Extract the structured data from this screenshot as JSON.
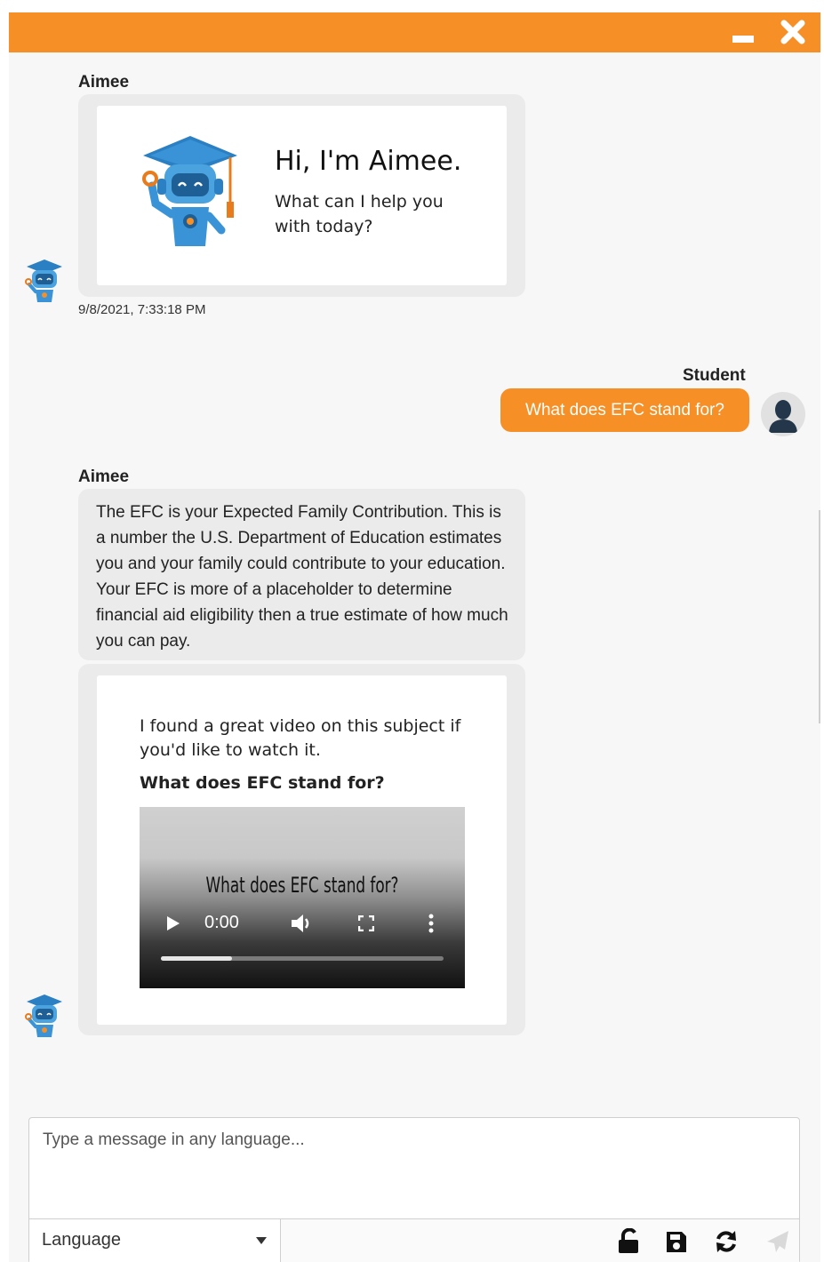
{
  "window": {
    "accent_color": "#f58f26",
    "minimize_icon": "minimize-icon",
    "close_icon": "close-icon"
  },
  "messages": {
    "greeting": {
      "sender": "Aimee",
      "title": "Hi, I'm Aimee.",
      "subtitle": "What can I help you with today?",
      "timestamp": "9/8/2021, 7:33:18 PM"
    },
    "student": {
      "sender": "Student",
      "text": "What does EFC stand for?"
    },
    "answer": {
      "sender": "Aimee",
      "text": "The EFC is your Expected Family Contribution. This is a number the U.S. Department of Education estimates you and your family could contribute to your education. Your EFC is more of a placeholder to determine financial aid eligibility then a true estimate of how much you can pay.",
      "video_intro": "I found a great video on this subject if you'd like to watch it.",
      "video_heading": "What does EFC stand for?",
      "video": {
        "title": "What does EFC stand for?",
        "time": "0:00",
        "progress": 0.25
      }
    }
  },
  "composer": {
    "placeholder": "Type a message in any language...",
    "language_label": "Language",
    "tools": [
      "unlock-icon",
      "save-icon",
      "refresh-icon",
      "send-icon"
    ]
  }
}
